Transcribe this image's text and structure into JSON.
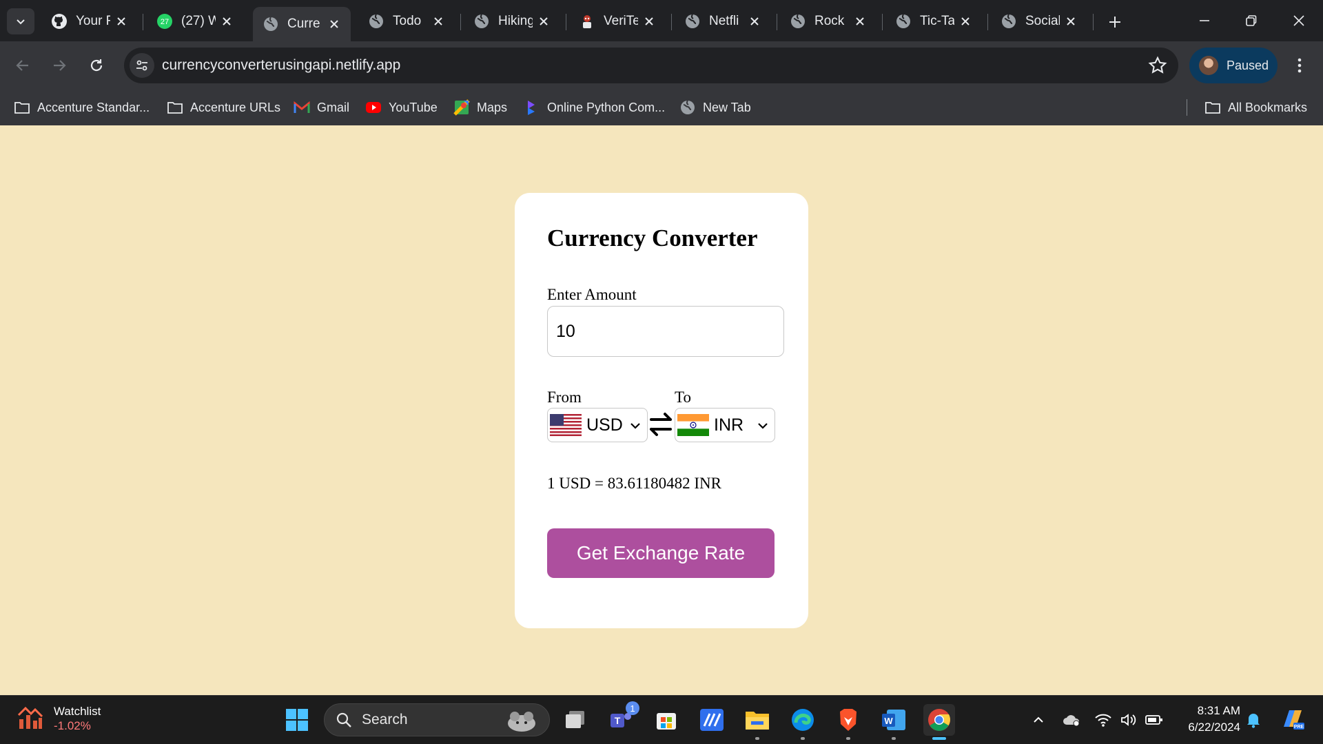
{
  "browser": {
    "tabs": [
      {
        "title": "Your R",
        "icon": "github-icon"
      },
      {
        "title": "(27) W",
        "icon": "whatsapp-icon",
        "badge": "27"
      },
      {
        "title": "Curre",
        "icon": "globe-icon",
        "active": true
      },
      {
        "title": "Todo",
        "icon": "globe-icon"
      },
      {
        "title": "Hiking",
        "icon": "globe-icon"
      },
      {
        "title": "VeriTe",
        "icon": "character-icon"
      },
      {
        "title": "Netfli",
        "icon": "globe-icon"
      },
      {
        "title": "Rock",
        "icon": "globe-icon"
      },
      {
        "title": "Tic-Ta",
        "icon": "globe-icon"
      },
      {
        "title": "Social",
        "icon": "globe-icon"
      }
    ],
    "url": "currencyconverterusingapi.netlify.app",
    "profile_status": "Paused",
    "bookmarks": [
      {
        "label": "Accenture Standar...",
        "icon": "folder-icon"
      },
      {
        "label": "Accenture URLs",
        "icon": "folder-icon"
      },
      {
        "label": "Gmail",
        "icon": "gmail-icon"
      },
      {
        "label": "YouTube",
        "icon": "youtube-icon"
      },
      {
        "label": "Maps",
        "icon": "maps-icon"
      },
      {
        "label": "Online Python Com...",
        "icon": "python-compiler-icon"
      },
      {
        "label": "New Tab",
        "icon": "globe-icon"
      }
    ],
    "all_bookmarks": "All Bookmarks"
  },
  "converter": {
    "title": "Currency Converter",
    "amount_label": "Enter Amount",
    "amount_value": "10",
    "from_label": "From",
    "to_label": "To",
    "from_currency": "USD",
    "to_currency": "INR",
    "rate_text": "1 USD = 83.61180482 INR",
    "button_label": "Get Exchange Rate",
    "colors": {
      "page_bg": "#f5e6bd",
      "button_bg": "#ad4f9e",
      "card_bg": "#ffffff"
    }
  },
  "taskbar": {
    "widget_title": "Watchlist",
    "widget_value": "-1.02%",
    "search_placeholder": "Search",
    "teams_badge": "1",
    "time": "8:31 AM",
    "date": "6/22/2024"
  }
}
